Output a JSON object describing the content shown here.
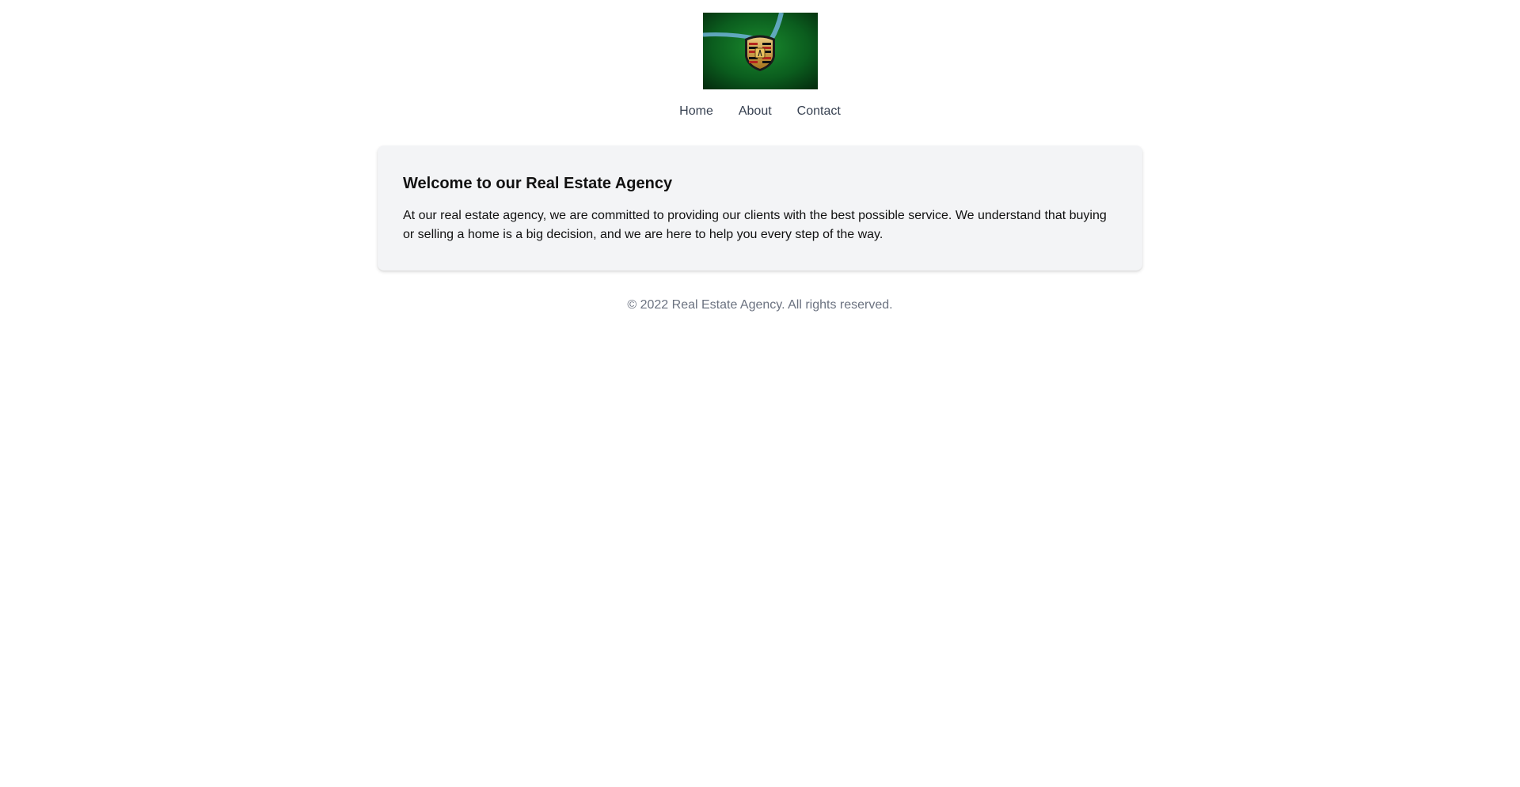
{
  "header": {
    "logo_alt": "logo",
    "nav": [
      {
        "label": "Home"
      },
      {
        "label": "About"
      },
      {
        "label": "Contact"
      }
    ]
  },
  "main": {
    "heading": "Welcome to our Real Estate Agency",
    "body": "At our real estate agency, we are committed to providing our clients with the best possible service. We understand that buying or selling a home is a big decision, and we are here to help you every step of the way."
  },
  "footer": {
    "copyright": "© 2022 Real Estate Agency. All rights reserved."
  },
  "colors": {
    "card_background": "#f3f4f6",
    "nav_text": "#374151",
    "footer_text": "#6b7280",
    "logo_background": "#0b5d1e"
  },
  "icons": {
    "logo": "crest-logo-image"
  }
}
